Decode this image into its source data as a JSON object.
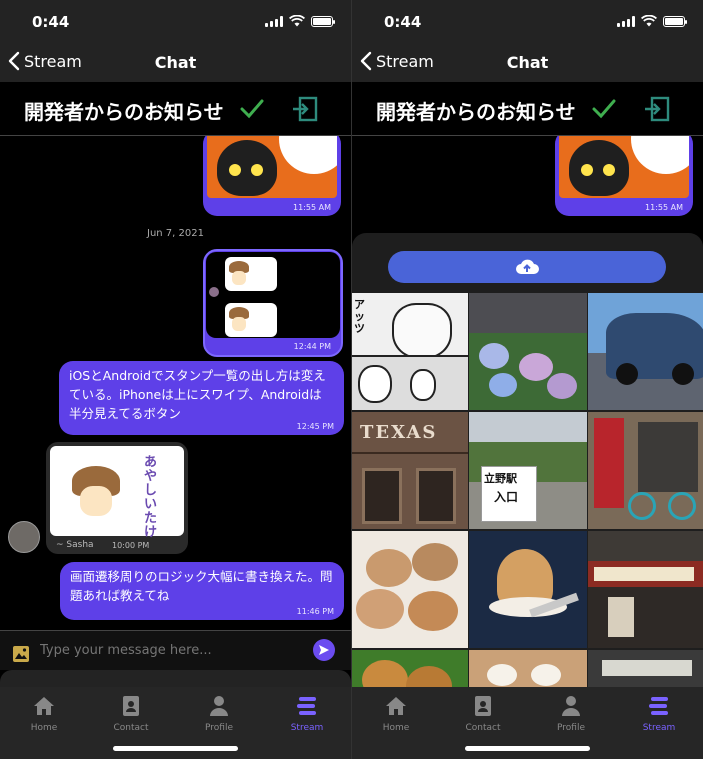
{
  "status": {
    "time": "0:44"
  },
  "nav": {
    "back_label": "Stream",
    "title": "Chat"
  },
  "room": {
    "title": "開発者からのお知らせ"
  },
  "messages": {
    "m1_time": "11:55 AM",
    "date1": "Jun 7, 2021",
    "m2_time": "12:44 PM",
    "m3_text": "iOSとAndroidでスタンプ一覧の出し方は変えている。iPhoneは上にスワイプ、Androidは半分見えてるボタン",
    "m3_time": "12:45 PM",
    "m4_sender": "~ Sasha",
    "m4_time": "10:00 PM",
    "m5_text": "画面遷移周りのロジック大幅に書き換えた。問題あれば教えてね",
    "m5_time": "11:46 PM"
  },
  "input": {
    "placeholder": "Type your message here..."
  },
  "tabs": [
    {
      "label": "Home",
      "icon": "home-icon"
    },
    {
      "label": "Contact",
      "icon": "contact-icon"
    },
    {
      "label": "Profile",
      "icon": "profile-icon"
    },
    {
      "label": "Stream",
      "icon": "stream-icon"
    }
  ],
  "sticker": {
    "text": "あやしいたけ"
  },
  "photos": {
    "station_sign": "立野駅",
    "station_sub": "入口",
    "texas_sign": "TEXAS",
    "manga_text": "アッツ"
  },
  "colors": {
    "accent": "#5e40e8",
    "active_tab": "#7a62ff",
    "upload": "#4a64d8",
    "check": "#3fae4f"
  }
}
